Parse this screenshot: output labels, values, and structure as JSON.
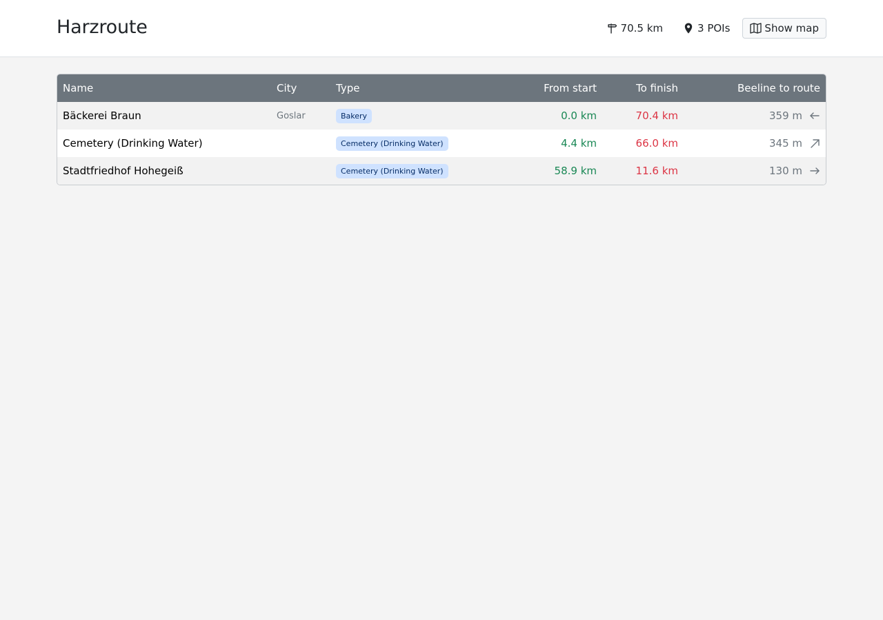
{
  "header": {
    "title": "Harzroute",
    "distance": "70.5 km",
    "pois": "3 POIs",
    "show_map_label": "Show map",
    "icons": {
      "distance": "signpost-icon",
      "pois": "map-pin-icon",
      "map": "map-icon"
    }
  },
  "table": {
    "columns": {
      "name": "Name",
      "city": "City",
      "type": "Type",
      "from_start": "From start",
      "to_finish": "To finish",
      "beeline": "Beeline to route"
    },
    "rows": [
      {
        "name": "Bäckerei Braun",
        "city": "Goslar",
        "type": "Bakery",
        "from_start": "0.0 km",
        "to_finish": "70.4 km",
        "beeline": "359 m",
        "direction_icon": "arrow-left-icon"
      },
      {
        "name": "Cemetery (Drinking Water)",
        "city": "",
        "type": "Cemetery (Drinking Water)",
        "from_start": "4.4 km",
        "to_finish": "66.0 km",
        "beeline": "345 m",
        "direction_icon": "arrow-up-right-icon"
      },
      {
        "name": "Stadtfriedhof Hohegeiß",
        "city": "",
        "type": "Cemetery (Drinking Water)",
        "from_start": "58.9 km",
        "to_finish": "11.6 km",
        "beeline": "130 m",
        "direction_icon": "arrow-right-icon"
      }
    ]
  },
  "colors": {
    "header_bg": "#6c757d",
    "from_start": "#198754",
    "to_finish": "#dc3545",
    "badge_bg": "#cfe2ff"
  }
}
